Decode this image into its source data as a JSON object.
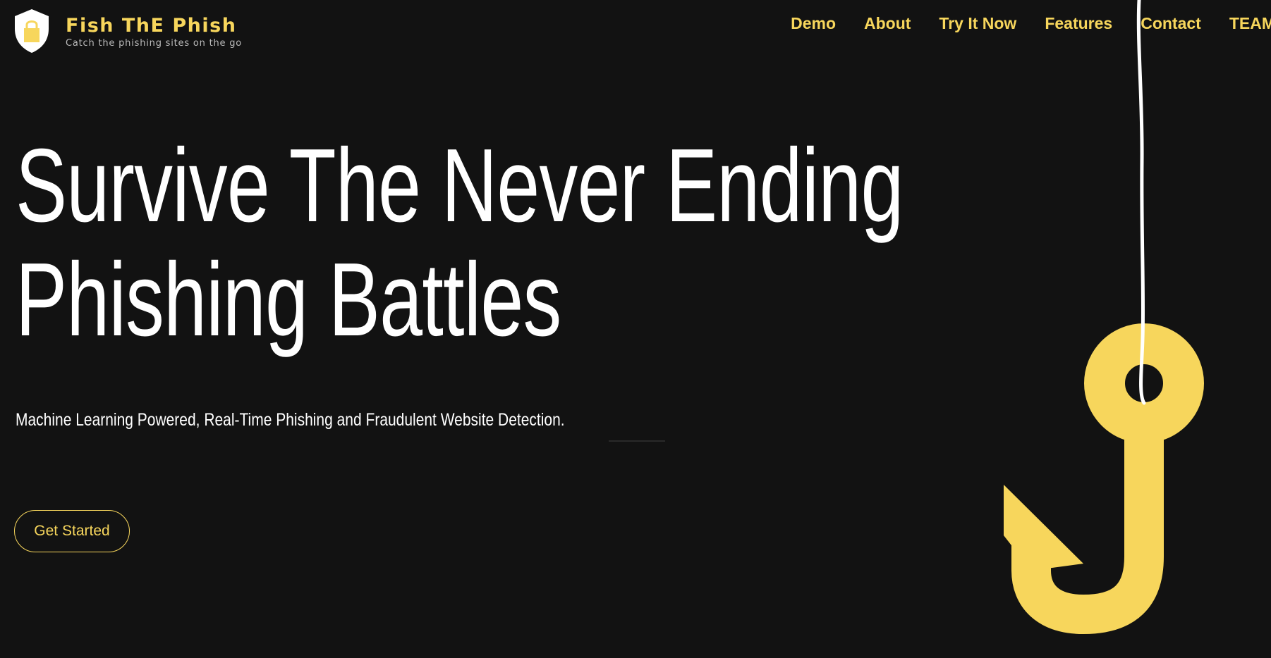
{
  "brand": {
    "name": "Fish ThE Phish",
    "tagline": "Catch the phishing sites on the go",
    "logo_icon": "shield-lock-icon"
  },
  "nav": {
    "items": [
      {
        "label": "Demo"
      },
      {
        "label": "About"
      },
      {
        "label": "Try It Now"
      },
      {
        "label": "Features"
      },
      {
        "label": "Contact"
      },
      {
        "label": "TEAM"
      }
    ]
  },
  "hero": {
    "title_line1": "Survive The Never Ending",
    "title_line2": "Phishing Battles",
    "subtitle": "Machine Learning Powered, Real-Time Phishing and Fraudulent Website Detection.",
    "cta_label": "Get Started",
    "illustration_icon": "fish-hook-icon"
  },
  "colors": {
    "background": "#121212",
    "accent": "#f7d65c",
    "text": "#ffffff"
  }
}
